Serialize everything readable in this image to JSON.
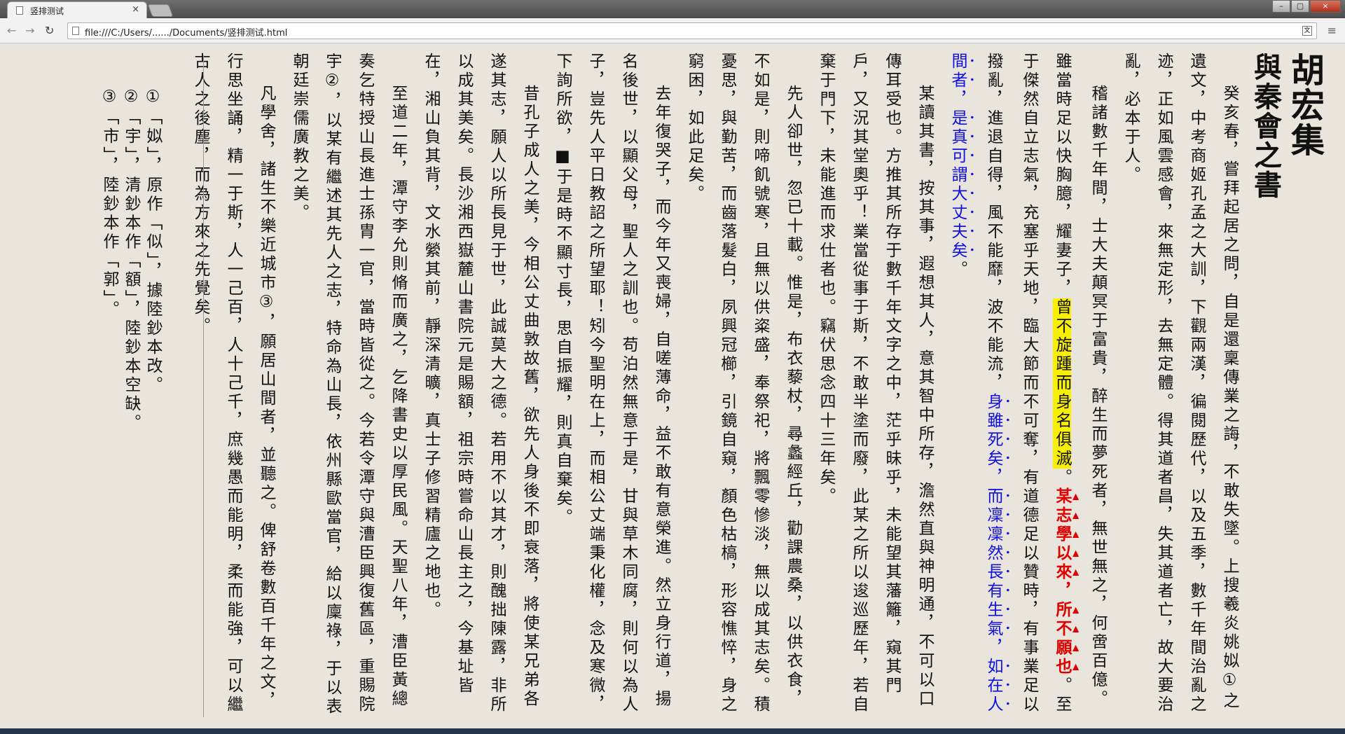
{
  "browser": {
    "tab_title": "竖排测试",
    "tab_close": "×",
    "url": "file:///C:/Users/....../Documents/竖排测试.html",
    "back": "←",
    "forward": "→",
    "reload": "↻",
    "menu": "≡",
    "min": "–",
    "max": "▢",
    "close": "×"
  },
  "document": {
    "book_title": "胡宏集",
    "section_title": "與秦會之書",
    "paragraphs": [
      {
        "segments": [
          {
            "text": "癸亥春，嘗拜起居之問，自是還稟傳業之誨，不敢失墜。上搜羲炎姚姒①之遺文，中考商姬孔孟之大訓，下觀兩漢，徧閱歷代，以及五季，數千年間治亂之迹，正如風雲感會，來無定形，去無定體。得其道者昌，失其道者亡，故大要治亂，必本于人。",
            "style": "normal"
          }
        ]
      },
      {
        "segments": [
          {
            "text": "稽諸數千年間，士大夫顛冥于富貴，醉生而夢死者，無世無之，何啻百億。雖當時足以快胸臆，耀妻子，",
            "style": "normal"
          },
          {
            "text": "曾不旋踵而身名俱滅",
            "style": "yellow"
          },
          {
            "text": "。",
            "style": "normal"
          },
          {
            "text": "某志學以來，所不願也",
            "style": "red"
          },
          {
            "text": "。至于傑然自立志氣，充塞乎天地，臨大節而不可奪，有道德足以贊時，有事業足以撥亂，進退自得，風不能靡，波不能流，",
            "style": "normal"
          },
          {
            "text": "身雖死矣，而凜凜然長有生氣，如在人間者，是真可謂大丈夫矣",
            "style": "blue"
          },
          {
            "text": "。",
            "style": "normal"
          }
        ]
      },
      {
        "segments": [
          {
            "text": "某讀其書，按其事，遐想其人，意其智中所存，澹然直與神明通，不可以口傳耳受也。方推其所存于數千年文字之中，茫乎昧乎，未能望其藩籬，窺其門戶，又況其堂奧乎！業當從事于斯，不敢半塗而廢，此某之所以逡巡歷年，若自棄于門下，未能進而求仕者也。竊伏思念四十三年矣。",
            "style": "normal"
          }
        ]
      },
      {
        "segments": [
          {
            "text": "先人卻世，忽已十載。惟是，布衣藜杖，尋蠡經丘，勸課農桑，以供衣食，不如是，則啼飢號寒，且無以供粢盛，奉祭祀，將飄零慘淡，無以成其志矣。積憂思，與勤苦，而齒落髮白，夙興冠櫛，引鏡自窺，顏色枯槁，形容憔悴，身之窮困，如此足矣。",
            "style": "normal"
          }
        ]
      },
      {
        "segments": [
          {
            "text": "去年復哭子，而今年又喪婦，自嗟薄命，益不敢有意榮進。然立身行道，揚名後世，以顯父母，聖人之訓也。苟泊然無意于是，甘與草木同腐，則何以為人子，豈先人平日教詔之所望耶！矧今聖明在上，而相公丈端秉化權，念及寒微，下詢所欲，■于是時不顯寸長，思自振耀，則真自棄矣。",
            "style": "normal"
          }
        ]
      },
      {
        "segments": [
          {
            "text": "昔孔子成人之美，今相公丈曲敦故舊，欲先人身後不即衰落，將使某兄弟各遂其志，願人以所長見于世，此誠莫大之德。若用不以其才，則醜拙陳露，非所以成其美矣。長沙湘西嶽麓山書院元是賜額，祖宗時嘗命山長主之，今基址皆在，湘山負其背，文水縈其前，靜深清曠，真士子修習精廬之地也。",
            "style": "normal"
          }
        ]
      },
      {
        "segments": [
          {
            "text": "至道二年，潭守李允則脩而廣之，乞降書史以厚民風。天聖八年，漕臣黃總奏乞特授山長進士孫胄一官，當時皆從之。今若令潭守與漕臣興復舊區，重賜院宇②，以某有繼述其先人之志，特命為山長，依州縣歐當官，給以廩祿，于以表朝廷崇儒廣教之美。",
            "style": "normal"
          }
        ]
      },
      {
        "segments": [
          {
            "text": "凡學舍，諸生不樂近城市③，願居山間者，並聽之。俾舒卷數百千年之文，行思坐誦，精一于斯，人一己百，人十己千，庶幾愚而能明，柔而能強，可以繼古人之後塵，而為方來之先覺矣。",
            "style": "normal"
          }
        ]
      }
    ],
    "notes": [
      "①「姒」，原作「似」，據陸鈔本改。",
      "②「宇」，清鈔本作「額」，陸鈔本空缺。",
      "③「市」，陸鈔本作「郭」。"
    ]
  }
}
